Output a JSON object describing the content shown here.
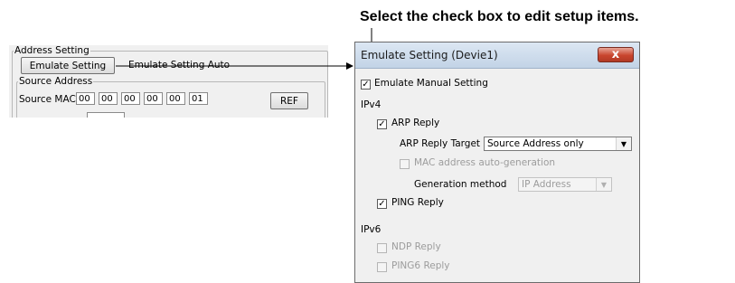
{
  "annotation": {
    "instruction": "Select the check box to edit setup items."
  },
  "left_window": {
    "group_address_setting": "Address Setting",
    "emulate_setting_button": "Emulate Setting",
    "emulate_setting_auto": "Emulate Setting Auto",
    "group_source_address": "Source Address",
    "source_mac_label": "Source MAC",
    "mac_octets": [
      "00",
      "00",
      "00",
      "00",
      "00",
      "01"
    ],
    "ref_button": "REF"
  },
  "dialog": {
    "title": "Emulate Setting (Devie1)",
    "close_glyph": "x",
    "emulate_manual_setting": {
      "label": "Emulate Manual Setting",
      "checked": true
    },
    "ipv4_label": "IPv4",
    "arp_reply": {
      "label": "ARP Reply",
      "checked": true
    },
    "arp_reply_target": {
      "label": "ARP Reply Target",
      "value": "Source Address only"
    },
    "mac_auto_generation": {
      "label": "MAC address auto-generation",
      "checked": false
    },
    "generation_method": {
      "label": "Generation method",
      "value": "IP Address"
    },
    "ping_reply": {
      "label": "PING Reply",
      "checked": true
    },
    "ipv6_label": "IPv6",
    "ndp_reply": {
      "label": "NDP Reply",
      "checked": false
    },
    "ping6_reply": {
      "label": "PING6 Reply",
      "checked": false
    }
  }
}
